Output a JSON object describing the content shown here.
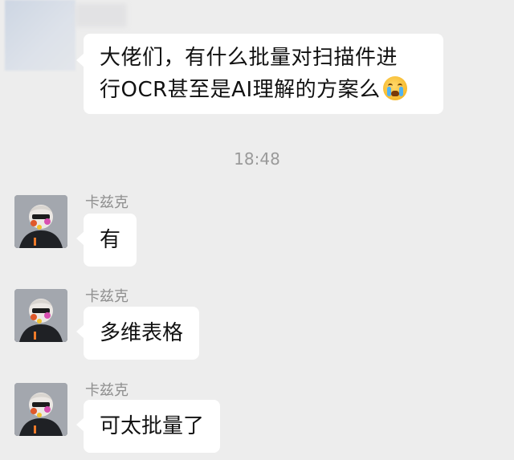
{
  "first_message": {
    "line1": "大佬们，有什么批量对扫描件进",
    "line2": "行OCR甚至是AI理解的方案么",
    "emoji": "crying-face"
  },
  "timestamp": "18:48",
  "replies": [
    {
      "sender": "卡兹克",
      "text": "有"
    },
    {
      "sender": "卡兹克",
      "text": "多维表格"
    },
    {
      "sender": "卡兹克",
      "text": "可太批量了"
    }
  ]
}
